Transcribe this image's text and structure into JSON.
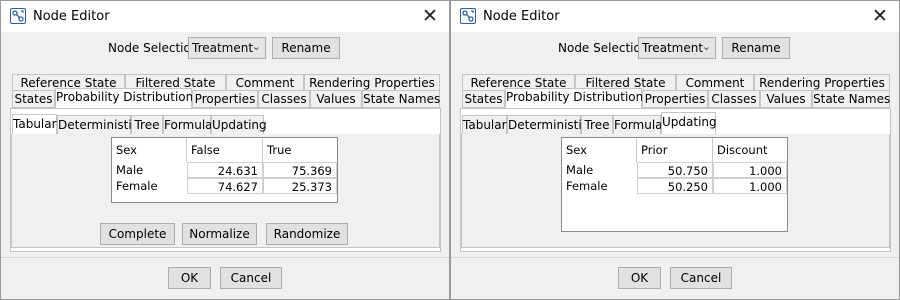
{
  "windows": [
    {
      "title": "Node Editor",
      "node_selection_label": "Node Selection:",
      "node_selection_value": "Treatment",
      "rename_label": "Rename",
      "tabs_row1": [
        "Reference State",
        "Filtered State",
        "Comment",
        "Rendering Properties"
      ],
      "tabs_row2": [
        "States",
        "Probability Distribution",
        "Properties",
        "Classes",
        "Values",
        "State Names"
      ],
      "selected_tab": "Probability Distribution",
      "subtabs": [
        "Tabular",
        "Deterministic",
        "Tree",
        "Formula",
        "Updating"
      ],
      "selected_subtab": "Tabular",
      "table": {
        "headers": [
          "Sex",
          "False",
          "True"
        ],
        "rows": [
          {
            "label": "Male",
            "values": [
              "24.631",
              "75.369"
            ]
          },
          {
            "label": "Female",
            "values": [
              "74.627",
              "25.373"
            ]
          }
        ]
      },
      "actions": [
        "Complete",
        "Normalize",
        "Randomize"
      ],
      "ok_label": "OK",
      "cancel_label": "Cancel"
    },
    {
      "title": "Node Editor",
      "node_selection_label": "Node Selection:",
      "node_selection_value": "Treatment",
      "rename_label": "Rename",
      "tabs_row1": [
        "Reference State",
        "Filtered State",
        "Comment",
        "Rendering Properties"
      ],
      "tabs_row2": [
        "States",
        "Probability Distribution",
        "Properties",
        "Classes",
        "Values",
        "State Names"
      ],
      "selected_tab": "Probability Distribution",
      "subtabs": [
        "Tabular",
        "Deterministic",
        "Tree",
        "Formula",
        "Updating"
      ],
      "selected_subtab": "Updating",
      "table": {
        "headers": [
          "Sex",
          "Prior Weight",
          "Discount"
        ],
        "rows": [
          {
            "label": "Male",
            "values": [
              "50.750",
              "1.000"
            ]
          },
          {
            "label": "Female",
            "values": [
              "50.250",
              "1.000"
            ]
          }
        ]
      },
      "ok_label": "OK",
      "cancel_label": "Cancel"
    }
  ],
  "icons": {
    "close": "close-icon",
    "app": "node-editor-app-icon",
    "dropdown": "chevron-down-icon"
  }
}
